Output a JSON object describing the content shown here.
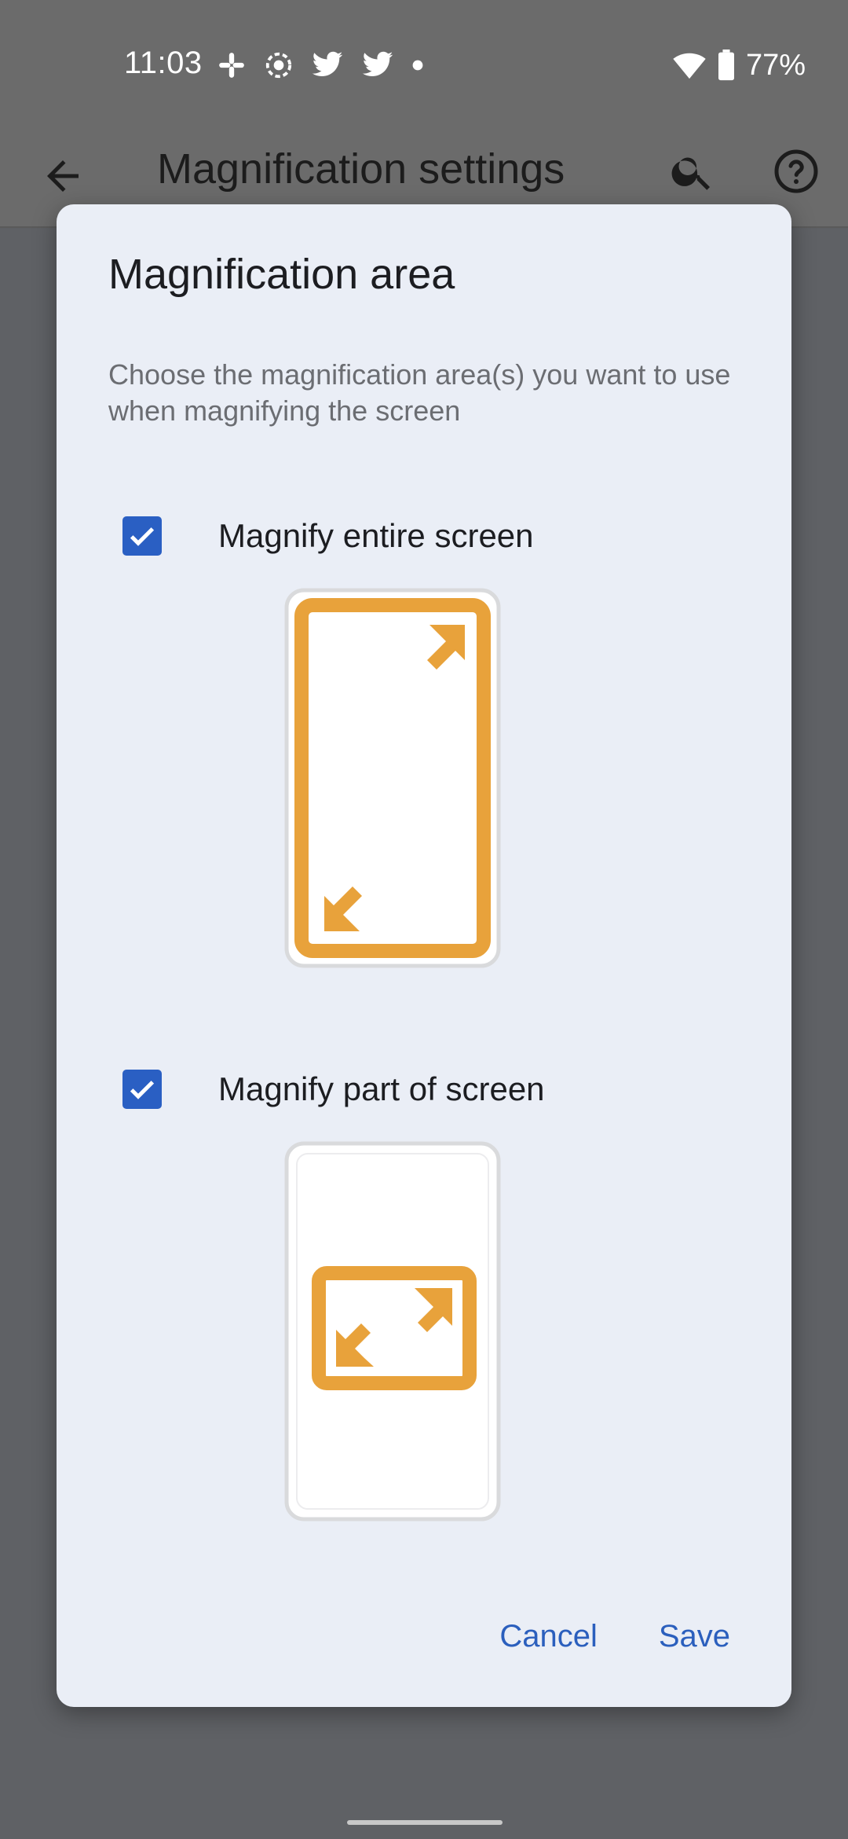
{
  "status_bar": {
    "time": "11:03",
    "notification_icons": [
      "slack-icon",
      "screen-record-icon",
      "twitter-icon",
      "twitter-icon",
      "dot-icon"
    ],
    "wifi_icon": "wifi-icon",
    "battery_icon": "battery-icon",
    "battery_percent": "77%"
  },
  "app_bar": {
    "title": "Magnification settings",
    "back_icon": "back-arrow-icon",
    "search_icon": "search-icon",
    "help_icon": "help-icon"
  },
  "dialog": {
    "title": "Magnification area",
    "description": "Choose the magnification area(s) you want to use when magnifying the screen",
    "options": [
      {
        "label": "Magnify entire screen",
        "checked": true,
        "illustration": "full-screen-magnification-illustration"
      },
      {
        "label": "Magnify part of screen",
        "checked": true,
        "illustration": "partial-screen-magnification-illustration"
      }
    ],
    "cancel_label": "Cancel",
    "save_label": "Save"
  },
  "colors": {
    "accent": "#2a5fc3",
    "illustration_orange": "#e8a23b",
    "dialog_bg": "#eaeef6",
    "scrim": "#5f6165"
  }
}
